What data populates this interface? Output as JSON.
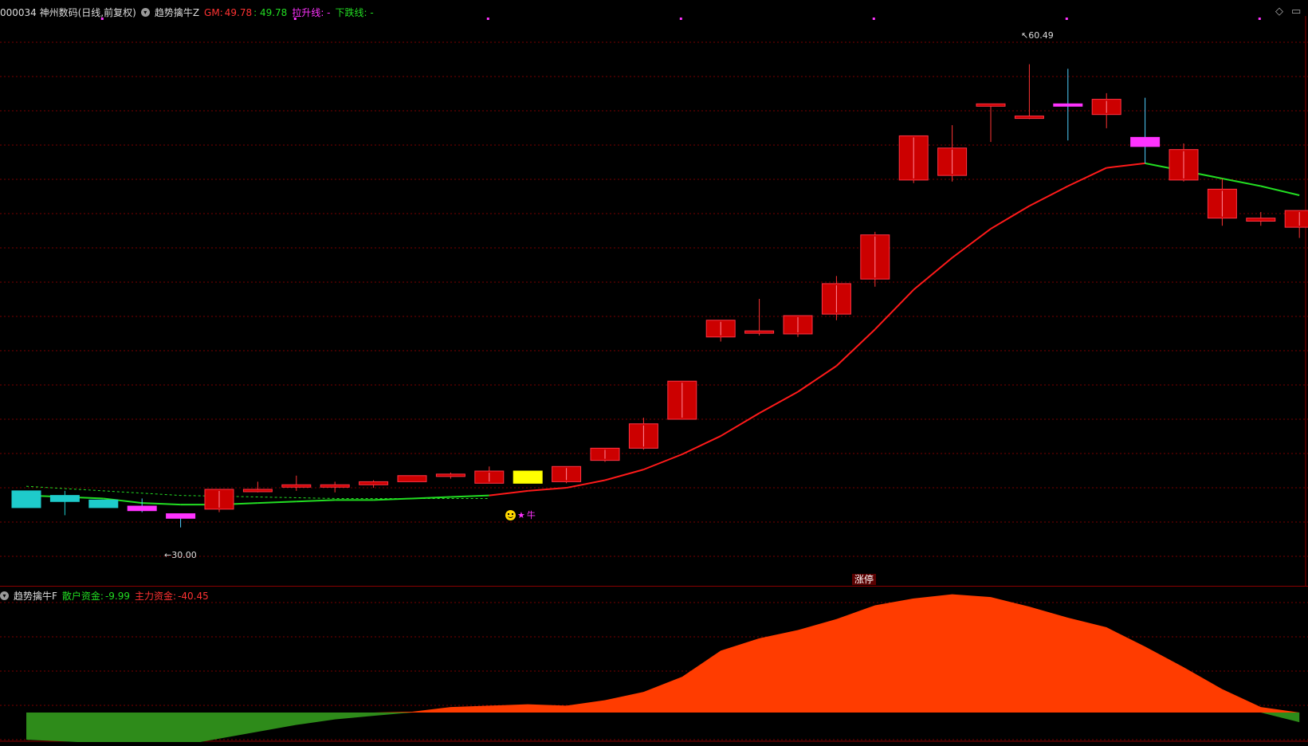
{
  "header": {
    "code_name": "000034 神州数码(日线,前复权)",
    "indicator_name": "趋势擒牛Z",
    "gm_label": "GM:",
    "gm_value": "49.78",
    "gm_value2": ": 49.78",
    "rise_label": "拉升线: -",
    "fall_label": "下跌线: -"
  },
  "controls": {
    "diamond": "◇",
    "window": "▭"
  },
  "annotations": {
    "high_label": "60.49",
    "low_label": "30.00",
    "signal_label": "牛",
    "limit_up_tag": "涨停"
  },
  "sub_header": {
    "name": "趋势擒牛F",
    "retail_label": "散户资金:",
    "retail_value": "-9.99",
    "main_label": "主力资金:",
    "main_value": "-40.45"
  },
  "colors": {
    "up_candle": "#cc0000",
    "down_candle": "#1ecbcb",
    "special_candle": "#ff33ff",
    "signal_candle": "#ffff00",
    "trend_red": "#ff1a1a",
    "trend_green": "#22dd22",
    "main_fund_area": "#ff3c00",
    "retail_fund_area": "#2e8b1a"
  },
  "chart_data": {
    "type": "candlestick",
    "y_range": [
      28,
      62
    ],
    "candles": [
      {
        "o": 32.4,
        "h": 32.4,
        "l": 31.3,
        "c": 31.3,
        "k": "down"
      },
      {
        "o": 32.1,
        "h": 32.4,
        "l": 30.8,
        "c": 31.7,
        "k": "down"
      },
      {
        "o": 31.8,
        "h": 31.8,
        "l": 31.3,
        "c": 31.3,
        "k": "down"
      },
      {
        "o": 31.4,
        "h": 31.9,
        "l": 31.0,
        "c": 31.1,
        "k": "special"
      },
      {
        "o": 30.9,
        "h": 30.9,
        "l": 30.0,
        "c": 30.6,
        "k": "special"
      },
      {
        "o": 31.2,
        "h": 32.5,
        "l": 31.0,
        "c": 32.5,
        "k": "up"
      },
      {
        "o": 32.5,
        "h": 33.0,
        "l": 32.3,
        "c": 32.5,
        "k": "up"
      },
      {
        "o": 32.7,
        "h": 33.4,
        "l": 32.4,
        "c": 32.8,
        "k": "up"
      },
      {
        "o": 32.7,
        "h": 33.0,
        "l": 32.3,
        "c": 32.8,
        "k": "up"
      },
      {
        "o": 32.8,
        "h": 33.1,
        "l": 32.6,
        "c": 33.0,
        "k": "up"
      },
      {
        "o": 33.0,
        "h": 33.4,
        "l": 33.0,
        "c": 33.4,
        "k": "up"
      },
      {
        "o": 33.4,
        "h": 33.6,
        "l": 33.2,
        "c": 33.5,
        "k": "up"
      },
      {
        "o": 32.9,
        "h": 34.0,
        "l": 32.9,
        "c": 33.7,
        "k": "up"
      },
      {
        "o": 32.9,
        "h": 33.7,
        "l": 32.9,
        "c": 33.7,
        "k": "signal"
      },
      {
        "o": 33.0,
        "h": 34.0,
        "l": 32.9,
        "c": 34.0,
        "k": "up"
      },
      {
        "o": 34.4,
        "h": 35.0,
        "l": 34.3,
        "c": 35.2,
        "k": "up"
      },
      {
        "o": 35.2,
        "h": 37.2,
        "l": 35.1,
        "c": 36.8,
        "k": "up"
      },
      {
        "o": 37.1,
        "h": 39.6,
        "l": 37.1,
        "c": 39.6,
        "k": "up"
      },
      {
        "o": 42.5,
        "h": 43.6,
        "l": 42.2,
        "c": 43.6,
        "k": "up"
      },
      {
        "o": 42.8,
        "h": 45.0,
        "l": 42.6,
        "c": 42.9,
        "k": "up"
      },
      {
        "o": 42.7,
        "h": 43.9,
        "l": 42.5,
        "c": 43.9,
        "k": "up"
      },
      {
        "o": 44.0,
        "h": 46.5,
        "l": 43.6,
        "c": 46.0,
        "k": "up"
      },
      {
        "o": 46.3,
        "h": 49.4,
        "l": 45.8,
        "c": 49.2,
        "k": "up"
      },
      {
        "o": 52.8,
        "h": 55.7,
        "l": 52.6,
        "c": 55.7,
        "k": "up"
      },
      {
        "o": 53.1,
        "h": 56.4,
        "l": 52.7,
        "c": 54.9,
        "k": "up"
      },
      {
        "o": 57.7,
        "h": 57.8,
        "l": 55.3,
        "c": 57.8,
        "k": "up"
      },
      {
        "o": 57.0,
        "h": 60.4,
        "l": 56.8,
        "c": 57.0,
        "k": "up_line"
      },
      {
        "o": 57.8,
        "h": 60.1,
        "l": 55.4,
        "c": 57.8,
        "k": "special_line"
      },
      {
        "o": 57.1,
        "h": 58.5,
        "l": 56.2,
        "c": 58.1,
        "k": "up"
      },
      {
        "o": 55.0,
        "h": 58.2,
        "l": 53.9,
        "c": 55.6,
        "k": "special"
      },
      {
        "o": 52.8,
        "h": 55.2,
        "l": 52.7,
        "c": 54.8,
        "k": "up"
      },
      {
        "o": 50.3,
        "h": 52.9,
        "l": 49.8,
        "c": 52.2,
        "k": "up"
      },
      {
        "o": 50.1,
        "h": 50.7,
        "l": 49.8,
        "c": 50.3,
        "k": "up"
      },
      {
        "o": 49.7,
        "h": 50.8,
        "l": 49.0,
        "c": 50.8,
        "k": "up"
      }
    ],
    "trend_line": [
      {
        "i": 0,
        "v": 32.1,
        "c": "green"
      },
      {
        "i": 1,
        "v": 32.0,
        "c": "green"
      },
      {
        "i": 2,
        "v": 31.9,
        "c": "green"
      },
      {
        "i": 3,
        "v": 31.6,
        "c": "green"
      },
      {
        "i": 4,
        "v": 31.5,
        "c": "green"
      },
      {
        "i": 5,
        "v": 31.5,
        "c": "green"
      },
      {
        "i": 6,
        "v": 31.6,
        "c": "green"
      },
      {
        "i": 7,
        "v": 31.7,
        "c": "green"
      },
      {
        "i": 8,
        "v": 31.8,
        "c": "green"
      },
      {
        "i": 9,
        "v": 31.8,
        "c": "green"
      },
      {
        "i": 10,
        "v": 31.9,
        "c": "green"
      },
      {
        "i": 11,
        "v": 32.0,
        "c": "green"
      },
      {
        "i": 12,
        "v": 32.1,
        "c": "green"
      },
      {
        "i": 13,
        "v": 32.4,
        "c": "red"
      },
      {
        "i": 14,
        "v": 32.6,
        "c": "red"
      },
      {
        "i": 15,
        "v": 33.1,
        "c": "red"
      },
      {
        "i": 16,
        "v": 33.8,
        "c": "red"
      },
      {
        "i": 17,
        "v": 34.8,
        "c": "red"
      },
      {
        "i": 18,
        "v": 36.0,
        "c": "red"
      },
      {
        "i": 19,
        "v": 37.5,
        "c": "red"
      },
      {
        "i": 20,
        "v": 38.9,
        "c": "red"
      },
      {
        "i": 21,
        "v": 40.6,
        "c": "red"
      },
      {
        "i": 22,
        "v": 43.0,
        "c": "red"
      },
      {
        "i": 23,
        "v": 45.6,
        "c": "red"
      },
      {
        "i": 24,
        "v": 47.7,
        "c": "red"
      },
      {
        "i": 25,
        "v": 49.6,
        "c": "red"
      },
      {
        "i": 26,
        "v": 51.1,
        "c": "red"
      },
      {
        "i": 27,
        "v": 52.4,
        "c": "red"
      },
      {
        "i": 28,
        "v": 53.6,
        "c": "red"
      },
      {
        "i": 29,
        "v": 53.9,
        "c": "red"
      },
      {
        "i": 30,
        "v": 53.4,
        "c": "green"
      },
      {
        "i": 31,
        "v": 52.9,
        "c": "green"
      },
      {
        "i": 32,
        "v": 52.4,
        "c": "green"
      },
      {
        "i": 33,
        "v": 51.8,
        "c": "green"
      }
    ],
    "dashed_line": [
      {
        "i": 0,
        "v": 32.7
      },
      {
        "i": 2,
        "v": 32.4
      },
      {
        "i": 4,
        "v": 32.1
      },
      {
        "i": 6,
        "v": 32.0
      },
      {
        "i": 8,
        "v": 31.9
      },
      {
        "i": 10,
        "v": 31.9
      },
      {
        "i": 12,
        "v": 31.9
      }
    ],
    "fund_flow": {
      "y_range": [
        -10,
        40
      ],
      "values": [
        -9.9,
        -10.5,
        -11.2,
        -11.6,
        -12.0,
        -9.5,
        -7.0,
        -4.5,
        -2.5,
        -1.2,
        0.3,
        2.0,
        2.5,
        3.0,
        2.5,
        4.5,
        7.5,
        13.0,
        22.5,
        27.0,
        30.0,
        34.0,
        39.0,
        41.5,
        43.0,
        42.0,
        38.5,
        34.5,
        31.0,
        24.0,
        16.5,
        8.5,
        2.0,
        -3.5
      ]
    }
  }
}
